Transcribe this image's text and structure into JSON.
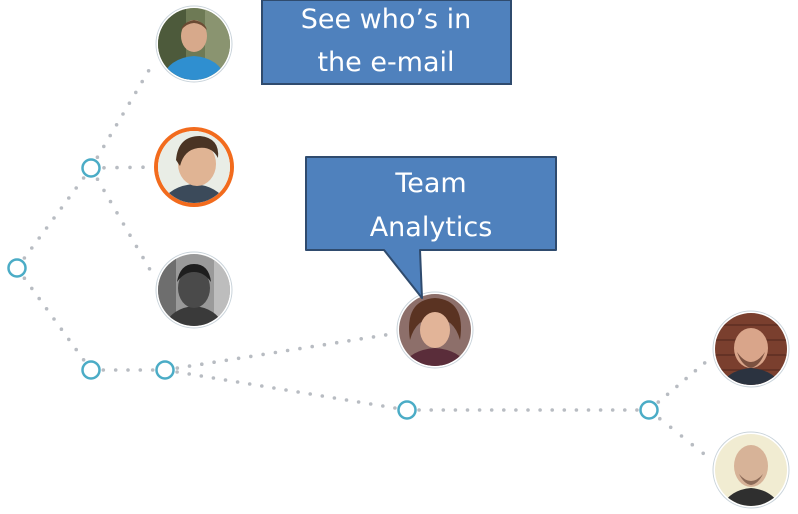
{
  "callouts": {
    "email": {
      "line1": "See who’s in",
      "line2": "the e-mail"
    },
    "team": {
      "line1": "Team",
      "line2": "Analytics"
    }
  },
  "colors": {
    "callout_fill": "#4f81bd",
    "callout_border": "#2f4b6e",
    "callout_text": "#ffffff",
    "node_stroke": "#4bacc6",
    "dot": "#b8bcc2",
    "highlight_ring": "#f26b1d"
  },
  "people": [
    {
      "name": "person-1-avatar",
      "desc": "man-in-blue-shirt"
    },
    {
      "name": "person-2-avatar",
      "desc": "man-highlighted"
    },
    {
      "name": "person-3-avatar",
      "desc": "man-grayscale"
    },
    {
      "name": "person-4-avatar",
      "desc": "woman-team-analytics"
    },
    {
      "name": "person-5-avatar",
      "desc": "bald-man-brick-wall"
    },
    {
      "name": "person-6-avatar",
      "desc": "bald-man-light-background"
    }
  ]
}
